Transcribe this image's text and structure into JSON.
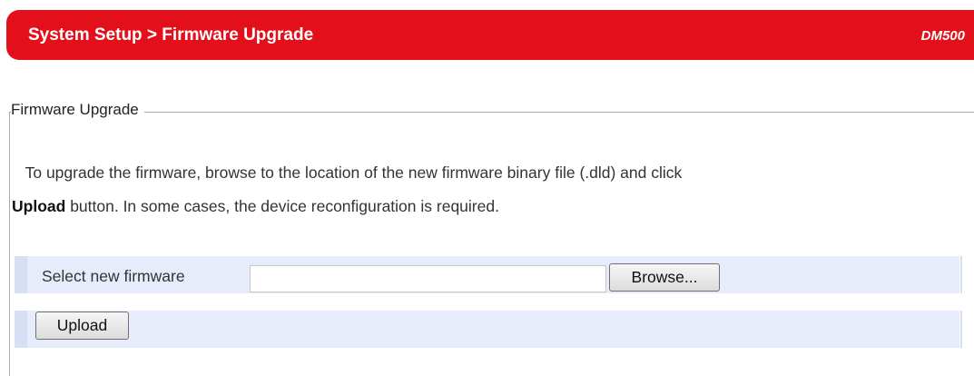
{
  "header": {
    "breadcrumb": "System Setup > Firmware Upgrade",
    "model": "DM500"
  },
  "section": {
    "legend": "Firmware Upgrade",
    "description_start": "To upgrade the firmware, browse to the location of the new firmware binary file (.dld) and click",
    "description_bold": "Upload",
    "description_end": "button. In some cases, the device reconfiguration is required."
  },
  "form": {
    "select_label": "Select new firmware",
    "file_value": "",
    "browse_label": "Browse...",
    "upload_label": "Upload"
  },
  "colors": {
    "header_bg": "#e3101c",
    "row_bg": "#e6ecfa"
  }
}
